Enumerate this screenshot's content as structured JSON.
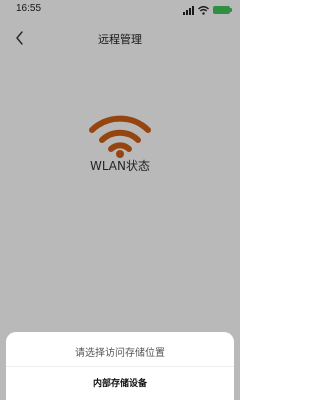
{
  "status_bar": {
    "time": "16:55"
  },
  "header": {
    "title": "远程管理"
  },
  "main": {
    "wlan_label": "WLAN状态"
  },
  "sheet": {
    "title": "请选择访问存储位置",
    "options": [
      "内部存储设备"
    ]
  },
  "colors": {
    "accent": "#c95e16",
    "battery": "#43c15c",
    "overlay": "#000000"
  },
  "icons": {
    "back": "chevron-left-icon",
    "wlan": "wifi-icon",
    "signal": "signal-icon",
    "wifi_status": "wifi-status-icon",
    "battery": "battery-icon"
  }
}
